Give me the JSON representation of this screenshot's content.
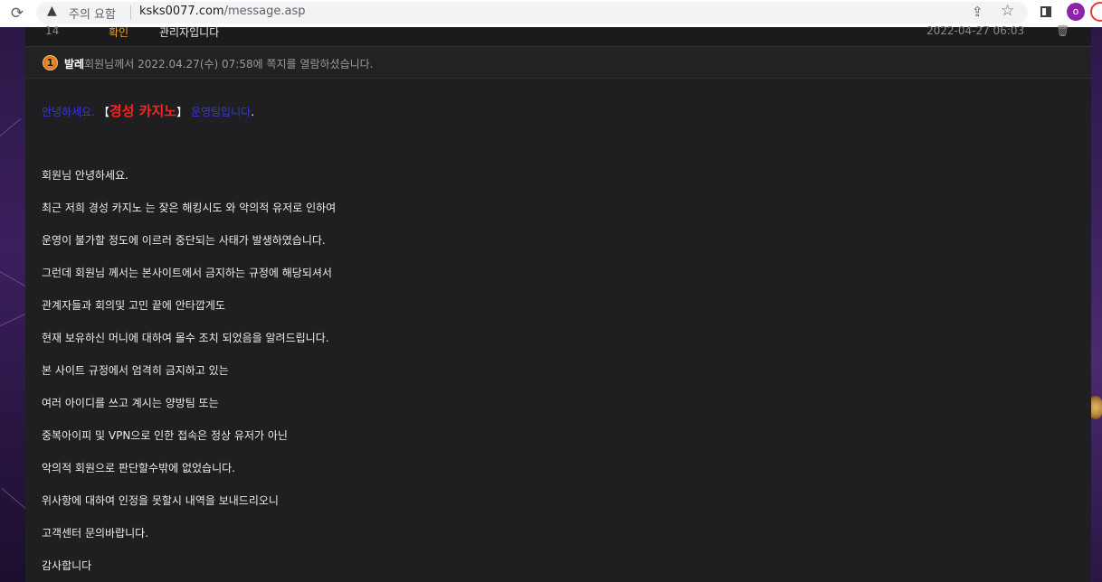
{
  "browser": {
    "security_label": "주의 요함",
    "url_host": "ksks0077.com",
    "url_path": "/message.asp",
    "avatar_initial": "o"
  },
  "message_row": {
    "number": "14",
    "status": "확인",
    "title": "관리자입니다",
    "date": "2022-04-27 06:03"
  },
  "read_notice": {
    "level": "1",
    "nickname": "발레",
    "text": "회원님께서 2022.04.27(수) 07:58에 쪽지를 열람하셨습니다."
  },
  "greeting": {
    "prefix": "안녕하세요.",
    "open_bracket": "【",
    "casino_name": "경성 카지노",
    "close_bracket": "】",
    "suffix": "운영팀입니다",
    "end": "."
  },
  "body_lines": [
    "회원님 안녕하세요.",
    "최근 저희 경성 카지노 는 잦은 해킹시도 와 악의적 유저로 인하여",
    "운영이 불가할 정도에 이르러 중단되는 사태가 발생하였습니다.",
    "그런데 회원님 께서는 본사이트에서 금지하는 규정에 해당되셔서",
    "관계자들과 회의및 고민 끝에 안타깝게도",
    "현재 보유하신 머니에 대하여 몰수 조치 되었음을 알려드립니다.",
    "본 사이트 규정에서 엄격히 금지하고 있는",
    "여러 아이디를 쓰고 계시는 양방팀 또는",
    "중복아이피 및 VPN으로 인한 접속은 정상 유저가 아닌",
    "악의적 회원으로 판단할수밖에 없었습니다.",
    "위사항에 대하여 인정을 못할시 내역을 보내드리오니",
    "고객센터 문의바랍니다.",
    "감사합니다"
  ],
  "colors": {
    "panel_bg": "#1f1f21",
    "status_orange": "#e6a23c",
    "casino_red": "#ff2020",
    "greeting_blue": "#3838d8"
  }
}
